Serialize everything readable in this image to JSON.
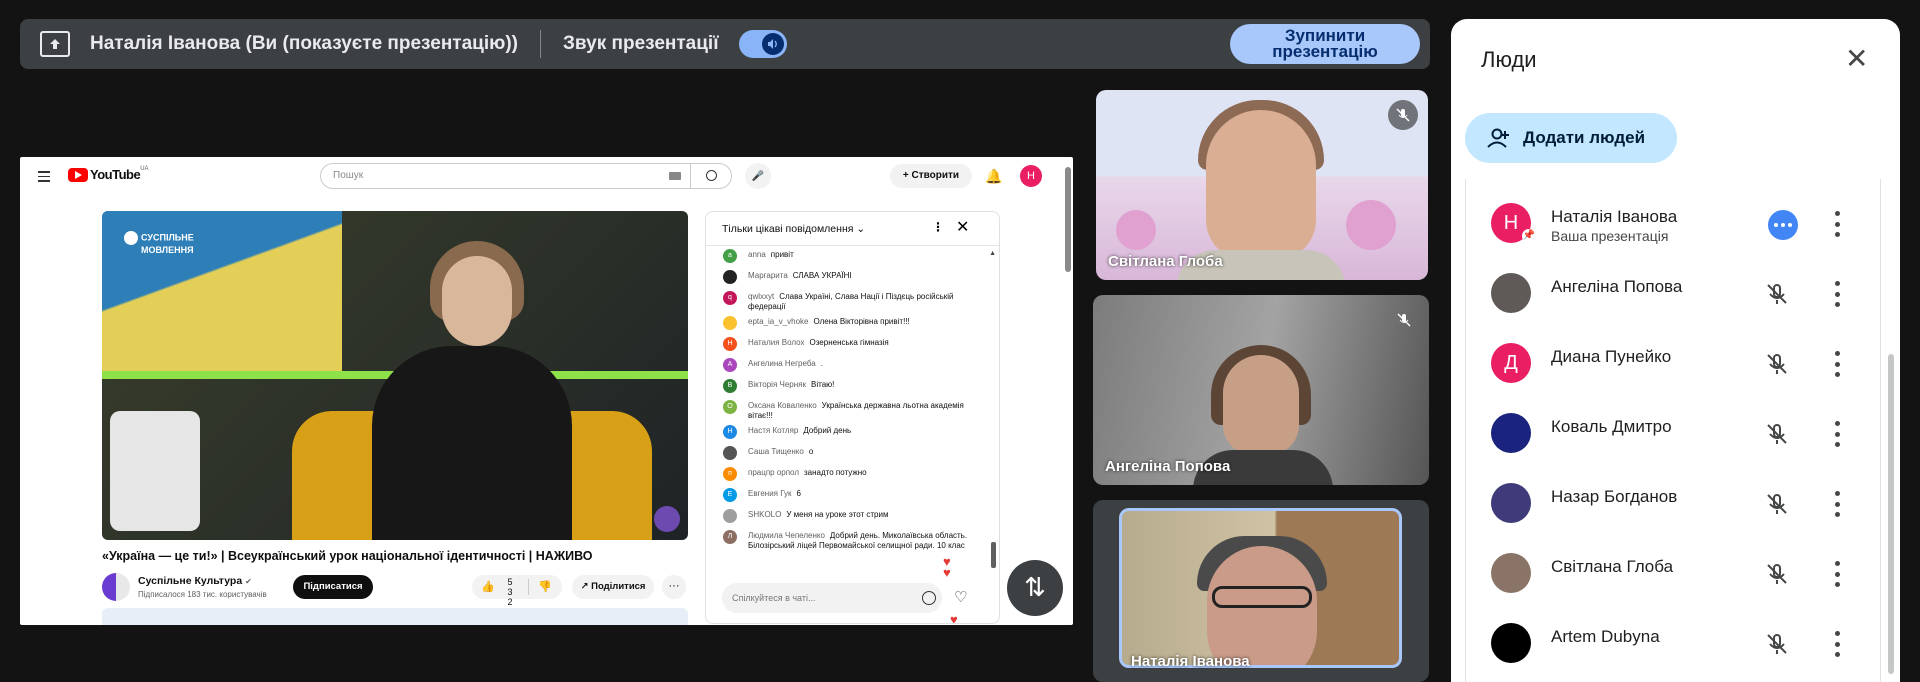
{
  "present_bar": {
    "presenter_label": "Наталія Іванова (Ви (показуєте презентацію))",
    "sound_label": "Звук презентації",
    "sound_on": true,
    "stop_label_line1": "Зупинити",
    "stop_label_line2": "презентацію"
  },
  "youtube": {
    "logo": "YouTube",
    "region": "UA",
    "search_placeholder": "Пошук",
    "create_label": "Створити",
    "avatar_letter": "Н",
    "video_watermark_line1": "СУСПІЛЬНЕ",
    "video_watermark_line2": "МОВЛЕННЯ",
    "video_title": "«Україна — це ти!» | Всеукраїнський урок національної ідентичності | НАЖИВО",
    "channel_name": "Суспільне Культура",
    "channel_subs": "Підписалося 183 тис. користувачів",
    "subscribe_label": "Підписатися",
    "likes_count_line1": "5",
    "likes_count_line2": "3",
    "likes_count_line3": "2",
    "share_label": "Поділитися",
    "chat": {
      "header": "Тільки цікаві повідомлення",
      "input_placeholder": "Спілкуйтеся в чаті...",
      "messages": [
        {
          "avatar": "a",
          "color": "#43a047",
          "author": "anna",
          "text": "привіт"
        },
        {
          "avatar": "",
          "color": "#222222",
          "author": "Маргарита",
          "text": "СЛАВА УКРАЇНІ"
        },
        {
          "avatar": "q",
          "color": "#c2185b",
          "author": "qwlxxyt",
          "text": "Слава Україні, Слава Нації і Піздєць російській федерації"
        },
        {
          "avatar": "",
          "color": "#fbc02d",
          "author": "epta_ia_v_vhoke",
          "text": "Олена Вікторівна привіт!!!"
        },
        {
          "avatar": "Н",
          "color": "#f4511e",
          "author": "Наталия Волох",
          "text": "Озерненська гімназія"
        },
        {
          "avatar": "А",
          "color": "#ab47bc",
          "author": "Ангелина Негреба",
          "text": "."
        },
        {
          "avatar": "В",
          "color": "#2e7d32",
          "author": "Вікторія Черняк",
          "text": "Вітаю!"
        },
        {
          "avatar": "О",
          "color": "#7cb342",
          "author": "Оксана Коваленко",
          "text": "Українська державна льотна академія вітає!!!"
        },
        {
          "avatar": "Н",
          "color": "#1e88e5",
          "author": "Настя Котляр",
          "text": "Добрий день"
        },
        {
          "avatar": "",
          "color": "#555555",
          "author": "Саша Тищенко",
          "text": "о"
        },
        {
          "avatar": "п",
          "color": "#fb8c00",
          "author": "працпр орпол",
          "text": "занадто потужно"
        },
        {
          "avatar": "Е",
          "color": "#039be5",
          "author": "Евгения Гук",
          "text": "6"
        },
        {
          "avatar": "",
          "color": "#9e9e9e",
          "author": "SHKOLO",
          "text": "У меня на уроке этот стрим"
        },
        {
          "avatar": "Л",
          "color": "#8d6e63",
          "author": "Людмила Чепеленко",
          "text": "Добрий день. Миколаївська область. Білозірський ліцей Первомайської селищної ради. 10 клас"
        }
      ]
    }
  },
  "tiles": [
    {
      "name": "Світлана Глоба",
      "muted": true
    },
    {
      "name": "Ангеліна Попова",
      "muted": true
    },
    {
      "name": "Наталія Іванова",
      "muted": false
    }
  ],
  "people_panel": {
    "title": "Люди",
    "add_label": "Додати людей",
    "people": [
      {
        "name": "Наталія Іванова",
        "sub": "Ваша презентація",
        "avatar_letter": "Н",
        "avatar_color": "#e91e63",
        "muted": false,
        "presenting": true
      },
      {
        "name": "Ангеліна Попова",
        "sub": "",
        "avatar_letter": "",
        "avatar_color": "#5f5a58",
        "muted": true,
        "presenting": false
      },
      {
        "name": "Диана Пунейко",
        "sub": "",
        "avatar_letter": "Д",
        "avatar_color": "#e91e63",
        "muted": true,
        "presenting": false
      },
      {
        "name": "Коваль Дмитро",
        "sub": "",
        "avatar_letter": "",
        "avatar_color": "#1a237e",
        "muted": true,
        "presenting": false
      },
      {
        "name": "Назар Богданов",
        "sub": "",
        "avatar_letter": "",
        "avatar_color": "#3f3b7a",
        "muted": true,
        "presenting": false
      },
      {
        "name": "Світлана Глоба",
        "sub": "",
        "avatar_letter": "",
        "avatar_color": "#8a7468",
        "muted": true,
        "presenting": false
      },
      {
        "name": "Artem Dubyna",
        "sub": "",
        "avatar_letter": "",
        "avatar_color": "#000000",
        "muted": true,
        "presenting": false
      }
    ]
  }
}
